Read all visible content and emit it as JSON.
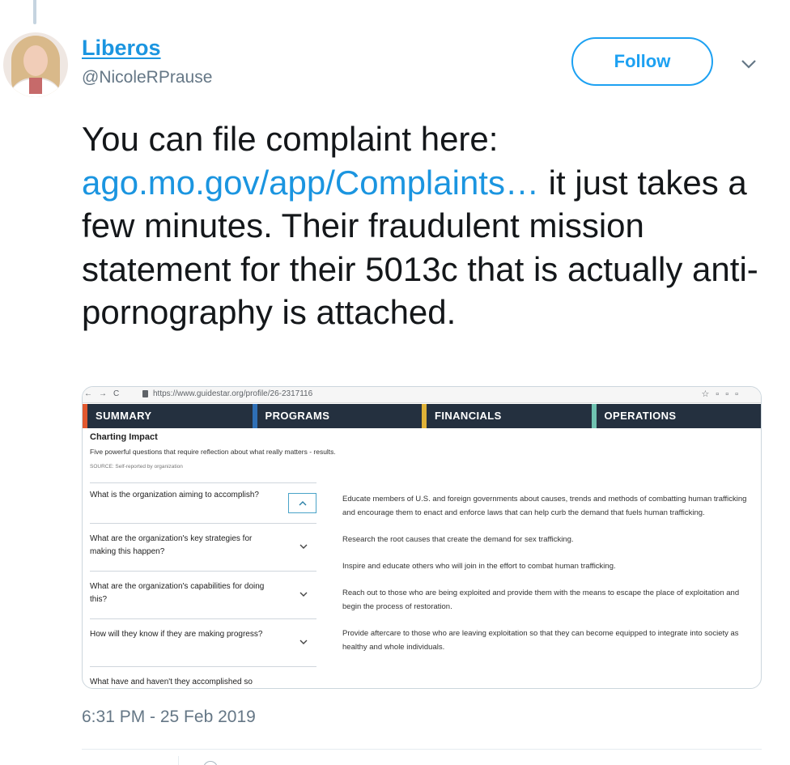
{
  "user": {
    "display_name": "Liberos",
    "handle": "@NicoleRPrause",
    "follow_label": "Follow"
  },
  "tweet": {
    "text_before_link": "You can file complaint here: ",
    "link_text": "ago.mo.gov/app/Complaints…",
    "text_after_link": " it just takes a few minutes. Their fraudulent mission statement for their 5013c that is actually anti-pornography is attached.",
    "timestamp": "6:31 PM - 25 Feb 2019"
  },
  "screenshot": {
    "browser": {
      "url": "https://www.guidestar.org/profile/26-2317116"
    },
    "tabs": [
      {
        "label": "SUMMARY",
        "color": "#e2582e"
      },
      {
        "label": "PROGRAMS",
        "color": "#2e6fb6"
      },
      {
        "label": "FINANCIALS",
        "color": "#e0b237"
      },
      {
        "label": "OPERATIONS",
        "color": "#6fc2b0"
      }
    ],
    "section_title": "Charting Impact",
    "section_subtitle": "Five powerful questions that require reflection about what really matters - results.",
    "source": "SOURCE: Self-reported by organization",
    "questions": [
      "What is the organization aiming to accomplish?",
      "What are the organization's key strategies for making this happen?",
      "What are the organization's capabilities for doing this?",
      "How will they know if they are making progress?",
      "What have and haven't they accomplished so"
    ],
    "answers": [
      "Educate members of U.S. and foreign governments about causes, trends and methods of combatting human trafficking and encourage them to enact and enforce laws that can help curb the demand that fuels human trafficking.",
      "Research the root causes that create the demand for sex trafficking.",
      "Inspire and educate others who will join in the effort to combat human trafficking.",
      "Reach out to those who are being exploited and provide them with the means to escape the place of exploitation and begin the process of restoration.",
      "Provide aftercare to those who are leaving exploitation so that they can become equipped to integrate into society as healthy and whole individuals."
    ]
  }
}
